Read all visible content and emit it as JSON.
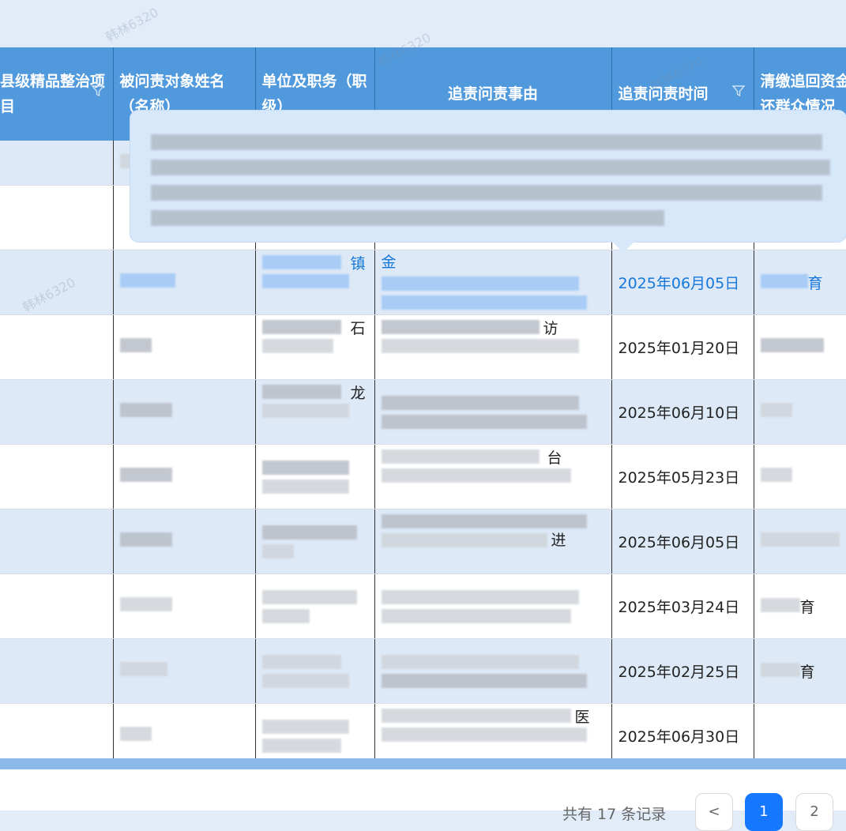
{
  "watermark": "韩林6320",
  "table": {
    "headers": [
      {
        "label": "县级精品整治项目",
        "filter": true
      },
      {
        "label": "被问责对象姓名（名称）",
        "filter": false
      },
      {
        "label": "单位及职务（职级）",
        "filter": false
      },
      {
        "label": "追责问责事由",
        "filter": false
      },
      {
        "label": "追责问责时间",
        "filter": true
      },
      {
        "label": "清缴追回资金返还群众情况",
        "filter": false
      }
    ],
    "dates": [
      "",
      "",
      "2025年06月05日",
      "2025年01月20日",
      "2025年06月10日",
      "2025年05月23日",
      "2025年06月05日",
      "2025年03月24日",
      "2025年02月25日",
      "2025年06月30日"
    ],
    "partial_texts": {
      "row3_col3": "镇",
      "row3_col4": "金",
      "row3_col6": "育",
      "row4_col3": "石",
      "row4_col4": "访",
      "row5_col3": "龙",
      "row6_col4": "台",
      "row7_col4": "进",
      "row8_col6": "育",
      "row9_col6": "育",
      "row10_col4": "医"
    }
  },
  "pagination": {
    "total_label": "共有 17 条记录",
    "prev_label": "<",
    "pages": [
      "1",
      "2"
    ],
    "current": "1"
  },
  "colors": {
    "header_bg": "#5099dc",
    "row_alt": "#dde9f7",
    "link": "#1677d9",
    "page_active": "#1677ff"
  }
}
